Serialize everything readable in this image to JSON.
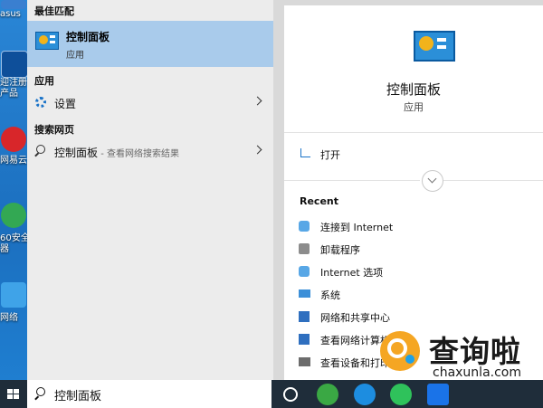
{
  "desktop": {
    "icons": [
      {
        "label": "asus",
        "top": 0
      },
      {
        "label": "迎注册",
        "sub": "产品"
      },
      {
        "label": "网易云"
      },
      {
        "label": "60安全",
        "sub": "器"
      },
      {
        "label": "网络"
      }
    ]
  },
  "search_panel": {
    "best_match_header": "最佳匹配",
    "best_match": {
      "title": "控制面板",
      "subtitle": "应用"
    },
    "apps_header": "应用",
    "apps": [
      {
        "label": "设置"
      }
    ],
    "web_header": "搜索网页",
    "web_results": [
      {
        "query": "控制面板",
        "suffix": " - 查看网络搜索结果"
      }
    ]
  },
  "detail": {
    "title": "控制面板",
    "subtitle": "应用",
    "open_label": "打开",
    "recent_header": "Recent",
    "recent": [
      "连接到 Internet",
      "卸载程序",
      "Internet 选项",
      "系统",
      "网络和共享中心",
      "查看网络计算机",
      "查看设备和打印"
    ]
  },
  "taskbar": {
    "search_value": "控制面板"
  },
  "watermark": {
    "text": "查询啦",
    "url": "chaxunla.com"
  }
}
